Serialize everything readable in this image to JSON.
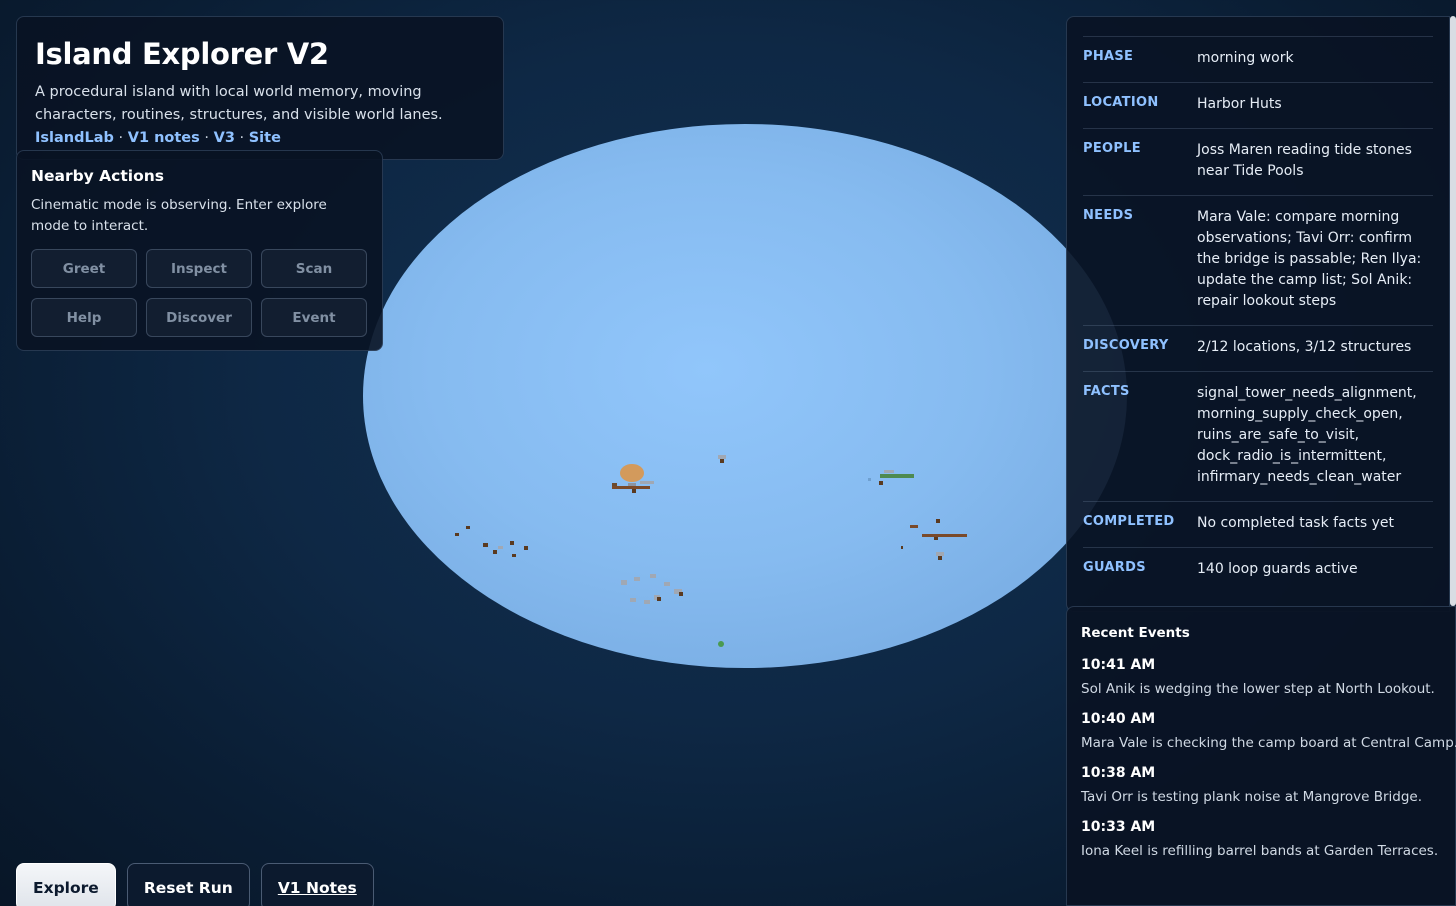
{
  "header": {
    "title": "Island Explorer V2",
    "description": "A procedural island with local world memory, moving characters, routines, structures, and visible world lanes.",
    "links": [
      "IslandLab",
      "V1 notes",
      "V3",
      "Site"
    ],
    "separator": "·"
  },
  "actions": {
    "title": "Nearby Actions",
    "note": "Cinematic mode is observing. Enter explore mode to interact.",
    "buttons": [
      "Greet",
      "Inspect",
      "Scan",
      "Help",
      "Discover",
      "Event"
    ]
  },
  "status": {
    "rows": [
      {
        "key": "PHASE",
        "value": "morning work"
      },
      {
        "key": "LOCATION",
        "value": "Harbor Huts"
      },
      {
        "key": "PEOPLE",
        "value": "Joss Maren reading tide stones near Tide Pools"
      },
      {
        "key": "NEEDS",
        "value": "Mara Vale: compare morning observations; Tavi Orr: confirm the bridge is passable; Ren Ilya: update the camp list; Sol Anik: repair lookout steps"
      },
      {
        "key": "DISCOVERY",
        "value": "2/12 locations, 3/12 structures"
      },
      {
        "key": "FACTS",
        "value": "signal_tower_needs_alignment, morning_supply_check_open, ruins_are_safe_to_visit, dock_radio_is_intermittent, infirmary_needs_clean_water"
      },
      {
        "key": "COMPLETED",
        "value": "No completed task facts yet"
      },
      {
        "key": "GUARDS",
        "value": "140 loop guards active"
      }
    ]
  },
  "events": {
    "title": "Recent Events",
    "items": [
      {
        "time": "10:41 AM",
        "text": "Sol Anik is wedging the lower step at North Lookout."
      },
      {
        "time": "10:40 AM",
        "text": "Mara Vale is checking the camp board at Central Camp."
      },
      {
        "time": "10:38 AM",
        "text": "Tavi Orr is testing plank noise at Mangrove Bridge."
      },
      {
        "time": "10:33 AM",
        "text": "Iona Keel is refilling barrel bands at Garden Terraces."
      }
    ]
  },
  "bottom": {
    "explore": "Explore",
    "reset": "Reset Run",
    "v1notes": "V1 Notes"
  },
  "colors": {
    "background": "#0e2845",
    "island": "#8cc2f8",
    "accent": "#8fc1ff",
    "panel": "#091324"
  }
}
